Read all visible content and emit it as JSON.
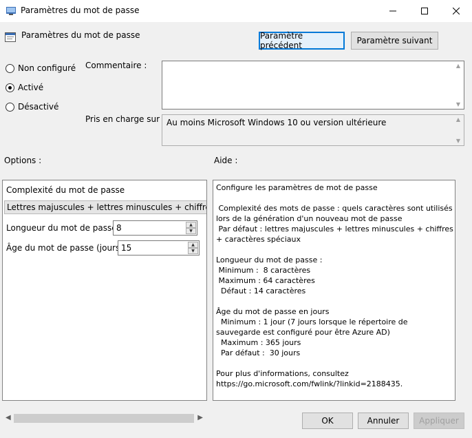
{
  "window": {
    "title": "Paramètres du mot de passe",
    "controls": {
      "minimize": "—",
      "maximize": "☐",
      "close": "✕"
    }
  },
  "header": {
    "title": "Paramètres du mot de passe",
    "prev_button": "Paramètre précédent",
    "next_button": "Paramètre suivant"
  },
  "state": {
    "options": [
      {
        "label": "Non configuré",
        "checked": false
      },
      {
        "label": "Activé",
        "checked": true
      },
      {
        "label": "Désactivé",
        "checked": false
      }
    ]
  },
  "comment": {
    "label": "Commentaire :",
    "value": ""
  },
  "supported": {
    "label": "Pris en charge sur :",
    "value": "Au moins Microsoft Windows 10 ou version ultérieure"
  },
  "options_section": {
    "label": "Options :",
    "complexity_label": "Complexité du mot de passe",
    "complexity_value": "Lettres majuscules + lettres minuscules + chiffres + spé",
    "length_label": "Longueur du mot de passe",
    "length_value": "8",
    "age_label": "Âge du mot de passe (jours)",
    "age_value": "15"
  },
  "help_section": {
    "label": "Aide :",
    "text": "Configure les paramètres de mot de passe\n\n Complexité des mots de passe : quels caractères sont utilisés lors de la génération d'un nouveau mot de passe\n Par défaut : lettres majuscules + lettres minuscules + chiffres + caractères spéciaux\n\nLongueur du mot de passe :\n Minimum :  8 caractères\n Maximum : 64 caractères\n  Défaut : 14 caractères\n\nÂge du mot de passe en jours\n  Minimum : 1 jour (7 jours lorsque le répertoire de sauvegarde est configuré pour être Azure AD)\n  Maximum : 365 jours\n  Par défaut :  30 jours\n\nPour plus d'informations, consultez\nhttps://go.microsoft.com/fwlink/?linkid=2188435."
  },
  "footer": {
    "ok": "OK",
    "cancel": "Annuler",
    "apply": "Appliquer"
  }
}
